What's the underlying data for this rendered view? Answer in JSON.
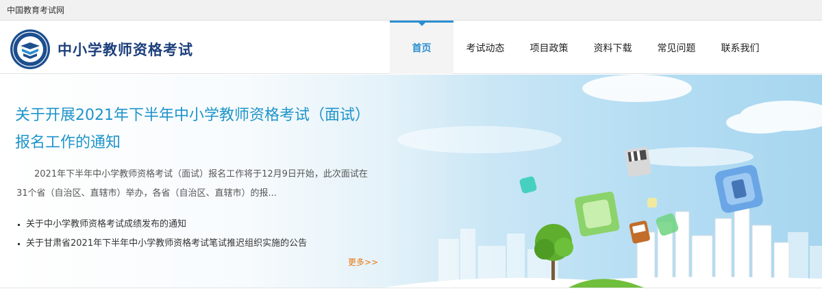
{
  "topbar": {
    "site_name": "中国教育考试网"
  },
  "header": {
    "brand": "中小学教师资格考试",
    "logo_icon": "book-emblem-icon",
    "nav": [
      {
        "label": "首页",
        "active": true
      },
      {
        "label": "考试动态",
        "active": false
      },
      {
        "label": "项目政策",
        "active": false
      },
      {
        "label": "资料下载",
        "active": false
      },
      {
        "label": "常见问题",
        "active": false
      },
      {
        "label": "联系我们",
        "active": false
      }
    ]
  },
  "banner": {
    "headline": "关于开展2021年下半年中小学教师资格考试（面试）报名工作的通知",
    "summary": "2021年下半年中小学教师资格考试（面试）报名工作将于12月9日开始，此次面试在31个省（自治区、直辖市）举办，各省（自治区、直辖市）的报...",
    "links": [
      "关于中小学教师资格考试成绩发布的通知",
      "关于甘肃省2021年下半年中小学教师资格考试笔试推迟组织实施的公告"
    ],
    "more": "更多>>"
  },
  "colors": {
    "accent": "#2a8fd1",
    "brand_navy": "#1c3f7c",
    "headline_blue": "#1e94c9",
    "more_orange": "#e8770f"
  }
}
